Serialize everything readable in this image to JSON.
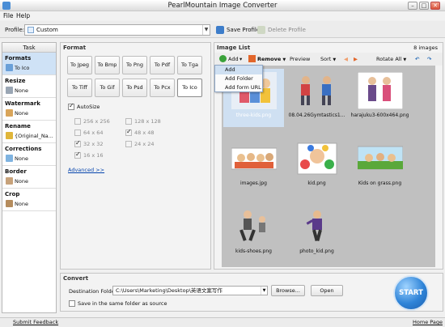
{
  "window": {
    "title": "PearlMountain Image Converter"
  },
  "menu": {
    "file": "File",
    "help": "Help"
  },
  "profile": {
    "label": "Profile:",
    "value": "Custom",
    "save_label": "Save Profile",
    "delete_label": "Delete Profile"
  },
  "tasks": {
    "header": "Task",
    "items": [
      {
        "name": "Formats",
        "value": "To Ico"
      },
      {
        "name": "Resize",
        "value": "None"
      },
      {
        "name": "Watermark",
        "value": "None"
      },
      {
        "name": "Rename",
        "value": "{Original_Na..."
      },
      {
        "name": "Corrections",
        "value": "None"
      },
      {
        "name": "Border",
        "value": "None"
      },
      {
        "name": "Crop",
        "value": "None"
      }
    ]
  },
  "format": {
    "title": "Format",
    "buttons": [
      "To Jpeg",
      "To Bmp",
      "To Png",
      "To Pdf",
      "To Tga",
      "To Tiff",
      "To Gif",
      "To Psd",
      "To Pcx",
      "To Ico"
    ],
    "selected": "To Ico",
    "autosize_label": "AutoSize",
    "sizes": [
      {
        "label": "256 x 256",
        "checked": false
      },
      {
        "label": "128 x 128",
        "checked": false
      },
      {
        "label": "64 x 64",
        "checked": false
      },
      {
        "label": "48 x 48",
        "checked": true
      },
      {
        "label": "32 x 32",
        "checked": true
      },
      {
        "label": "24 x 24",
        "checked": false
      },
      {
        "label": "16 x 16",
        "checked": true
      }
    ],
    "advanced_label": "Advanced >>"
  },
  "image_list": {
    "title": "Image List",
    "count": "8 images",
    "toolbar": {
      "add": "Add",
      "remove": "Remove",
      "preview": "Preview",
      "sort": "Sort",
      "rotate": "Rotate All"
    },
    "add_menu": [
      "Add",
      "Add Folder",
      "Add form URL"
    ],
    "images": [
      {
        "name": "three-kids.png"
      },
      {
        "name": "08.04.26Gymtastics1..."
      },
      {
        "name": "harajuku3-600x464.png"
      },
      {
        "name": "images.jpg"
      },
      {
        "name": "kid.png"
      },
      {
        "name": "Kids on grass.png"
      },
      {
        "name": "kids-shoes.png"
      },
      {
        "name": "photo_kid.png"
      }
    ]
  },
  "convert": {
    "title": "Convert",
    "dest_label": "Destination Folder:",
    "dest_value": "C:\\Users\\Marketing\\Desktop\\英语文案写作",
    "browse": "Browse...",
    "open": "Open",
    "same_folder": "Save in the same folder as source",
    "start": "START"
  },
  "status": {
    "feedback": "Submit Feedback",
    "home": "Home Page"
  }
}
